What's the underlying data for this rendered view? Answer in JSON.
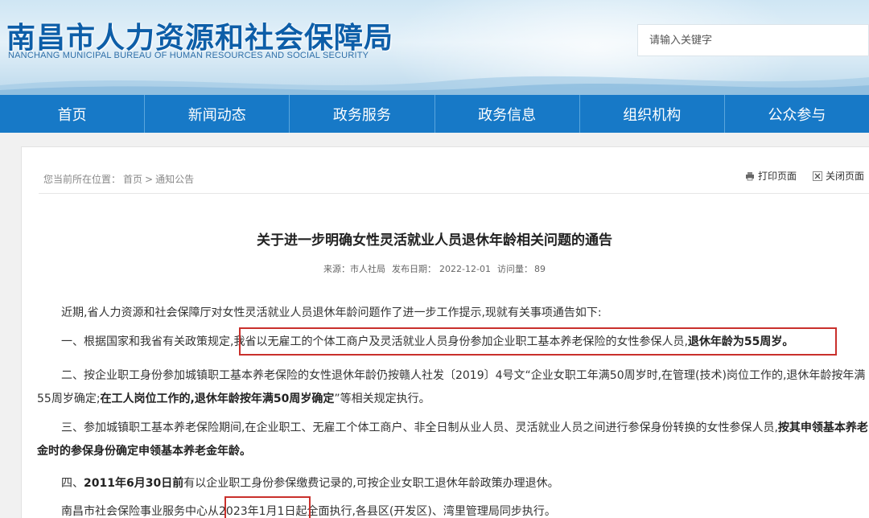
{
  "header": {
    "site_title": "南昌市人力资源和社会保障局",
    "site_subtitle": "NANCHANG MUNICIPAL BUREAU OF HUMAN RESOURCES AND SOCIAL SECURITY",
    "search_placeholder": "请输入关键字"
  },
  "nav": {
    "items": [
      {
        "label": "首页"
      },
      {
        "label": "新闻动态"
      },
      {
        "label": "政务服务"
      },
      {
        "label": "政务信息"
      },
      {
        "label": "组织机构"
      },
      {
        "label": "公众参与"
      }
    ]
  },
  "breadcrumb": {
    "prefix": "您当前所在位置：",
    "home": "首页",
    "sep": ">",
    "current": "通知公告"
  },
  "tools": {
    "print_label": "打印页面",
    "close_label": "关闭页面"
  },
  "article": {
    "title": "关于进一步明确女性灵活就业人员退休年龄相关问题的通告",
    "source_label": "来源：市人社局",
    "date_label": "发布日期：",
    "date": "2022-12-01",
    "views_label": "访问量：",
    "views": "89",
    "p0": "近期,省人力资源和社会保障厅对女性灵活就业人员退休年龄问题作了进一步工作提示,现就有关事项通告如下:",
    "p1_a": "一、根据国家和我省有关政策规定,",
    "p1_b": "我省以无雇工的个体工商户及灵活就业人员身份参加企业职工基本养老保险的女性参保人员,",
    "p1_c": "退休年龄为55周岁。",
    "p2_a": "二、按企业职工身份参加城镇职工基本养老保险的女性退休年龄仍按赣人社发〔2019〕4号文“企业女职工年满50周岁时,在管理(技术)岗位工作的,退休年龄按年满55周岁确定;",
    "p2_b": "在工人岗位工作的,退休年龄按年满50周岁确定",
    "p2_c": "”等相关规定执行。",
    "p3_a": "三、参加城镇职工基本养老保险期间,在企业职工、无雇工个体工商户、非全日制从业人员、灵活就业人员之间进行参保身份转换的女性参保人员,",
    "p3_b": "按其申领基本养老金时的参保身份确定申领基本养老金年龄。",
    "p4_a": "四、",
    "p4_b": "2011年6月30日前",
    "p4_c": "有以企业职工身份参保缴费记录的,可按企业女职工退休年龄政策办理退休。",
    "p5": "南昌市社会保险事业服务中心从2023年1月1日起全面执行,各县区(开发区)、湾里管理局同步执行。"
  }
}
